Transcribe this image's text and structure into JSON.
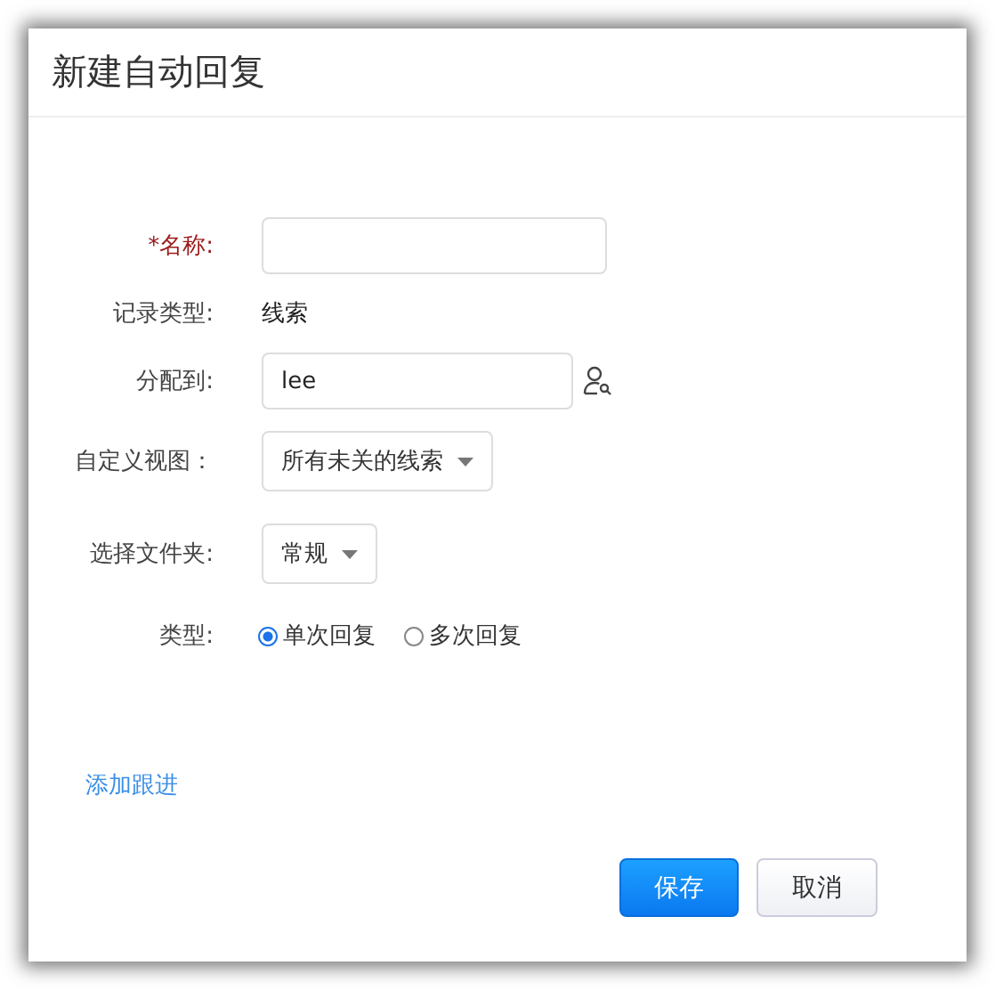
{
  "dialog": {
    "title": "新建自动回复"
  },
  "fields": [
    {
      "kind": "input",
      "label": "*名称:",
      "required": true
    },
    {
      "kind": "text",
      "label": "记录类型:",
      "required": false,
      "value": "线索"
    },
    {
      "kind": "lookup",
      "label": "分配到:",
      "required": false,
      "value": "lee"
    },
    {
      "kind": "select",
      "label": "自定义视图：",
      "required": false,
      "value": "所有未关的线索"
    },
    {
      "kind": "select",
      "label": "选择文件夹:",
      "required": false,
      "value": "常规"
    },
    {
      "kind": "radio",
      "label": "类型:",
      "required": false,
      "options": [
        {
          "label": "单次回复",
          "selected": true
        },
        {
          "label": "多次回复",
          "selected": false
        }
      ]
    }
  ],
  "link": "添加跟进",
  "buttons": [
    {
      "label": "保存",
      "kind": "primary"
    },
    {
      "label": "取消",
      "kind": "secondary"
    }
  ]
}
